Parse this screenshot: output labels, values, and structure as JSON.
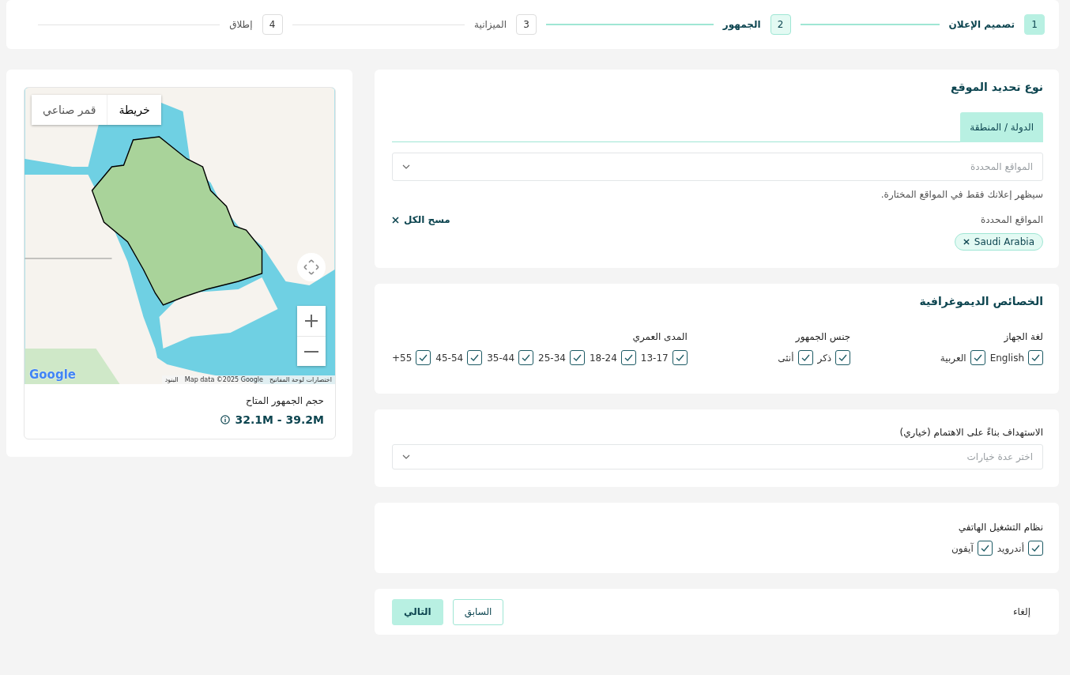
{
  "stepper": {
    "steps": [
      {
        "number": "1",
        "label": "تصميم الإعلان",
        "completed": true,
        "selected": false
      },
      {
        "number": "2",
        "label": "الجمهور",
        "completed": false,
        "selected": true
      },
      {
        "number": "3",
        "label": "الميزانية",
        "completed": false,
        "selected": false
      },
      {
        "number": "4",
        "label": "إطلاق",
        "completed": false,
        "selected": false
      }
    ]
  },
  "location": {
    "title": "نوع تحديد الموقع",
    "tabs": [
      {
        "label": "الدولة / المنطقة",
        "selected": true
      }
    ],
    "select": {
      "placeholder": "المواقع المحددة"
    },
    "hint": "سيظهر إعلانك فقط في المواقع المختارة.",
    "selected_label": "المواقع المحددة",
    "clear_all": "مسح الكل",
    "chips": [
      "Saudi Arabia"
    ]
  },
  "demographics": {
    "title": "الخصائص الديموغرافية",
    "groups": [
      {
        "label": "لغة الجهاز",
        "options": [
          {
            "label": "English",
            "checked": true
          },
          {
            "label": "العربية",
            "checked": true
          }
        ]
      },
      {
        "label": "جنس الجمهور",
        "options": [
          {
            "label": "ذكر",
            "checked": true
          },
          {
            "label": "أنثى",
            "checked": true
          }
        ]
      },
      {
        "label": "المدى العمري",
        "options": [
          {
            "label": "13-17",
            "checked": true
          },
          {
            "label": "18-24",
            "checked": true
          },
          {
            "label": "25-34",
            "checked": true
          },
          {
            "label": "35-44",
            "checked": true
          },
          {
            "label": "45-54",
            "checked": true
          },
          {
            "label": "55+",
            "checked": true
          }
        ]
      }
    ]
  },
  "interests": {
    "label": "الاستهداف بناءً على الاهتمام (خياري)",
    "select": {
      "placeholder": "اختر عدة خيارات"
    }
  },
  "os": {
    "label": "نظام التشغيل الهاتفي",
    "options": [
      {
        "label": "أندرويد",
        "checked": true
      },
      {
        "label": "آيفون",
        "checked": true
      }
    ]
  },
  "footer": {
    "cancel": "إلغاء",
    "previous": "السابق",
    "next": "التالي"
  },
  "map": {
    "map_types": [
      {
        "label": "خريطة",
        "selected": true
      },
      {
        "label": "قمر صناعي",
        "selected": false
      }
    ],
    "logo": "Google",
    "attribution": [
      "اختصارات لوحة المفاتيح",
      "Map data ©2025 Google",
      "البنود"
    ]
  },
  "audience": {
    "label": "حجم الجمهور المتاح",
    "value": "32.1M - 39.2M"
  }
}
